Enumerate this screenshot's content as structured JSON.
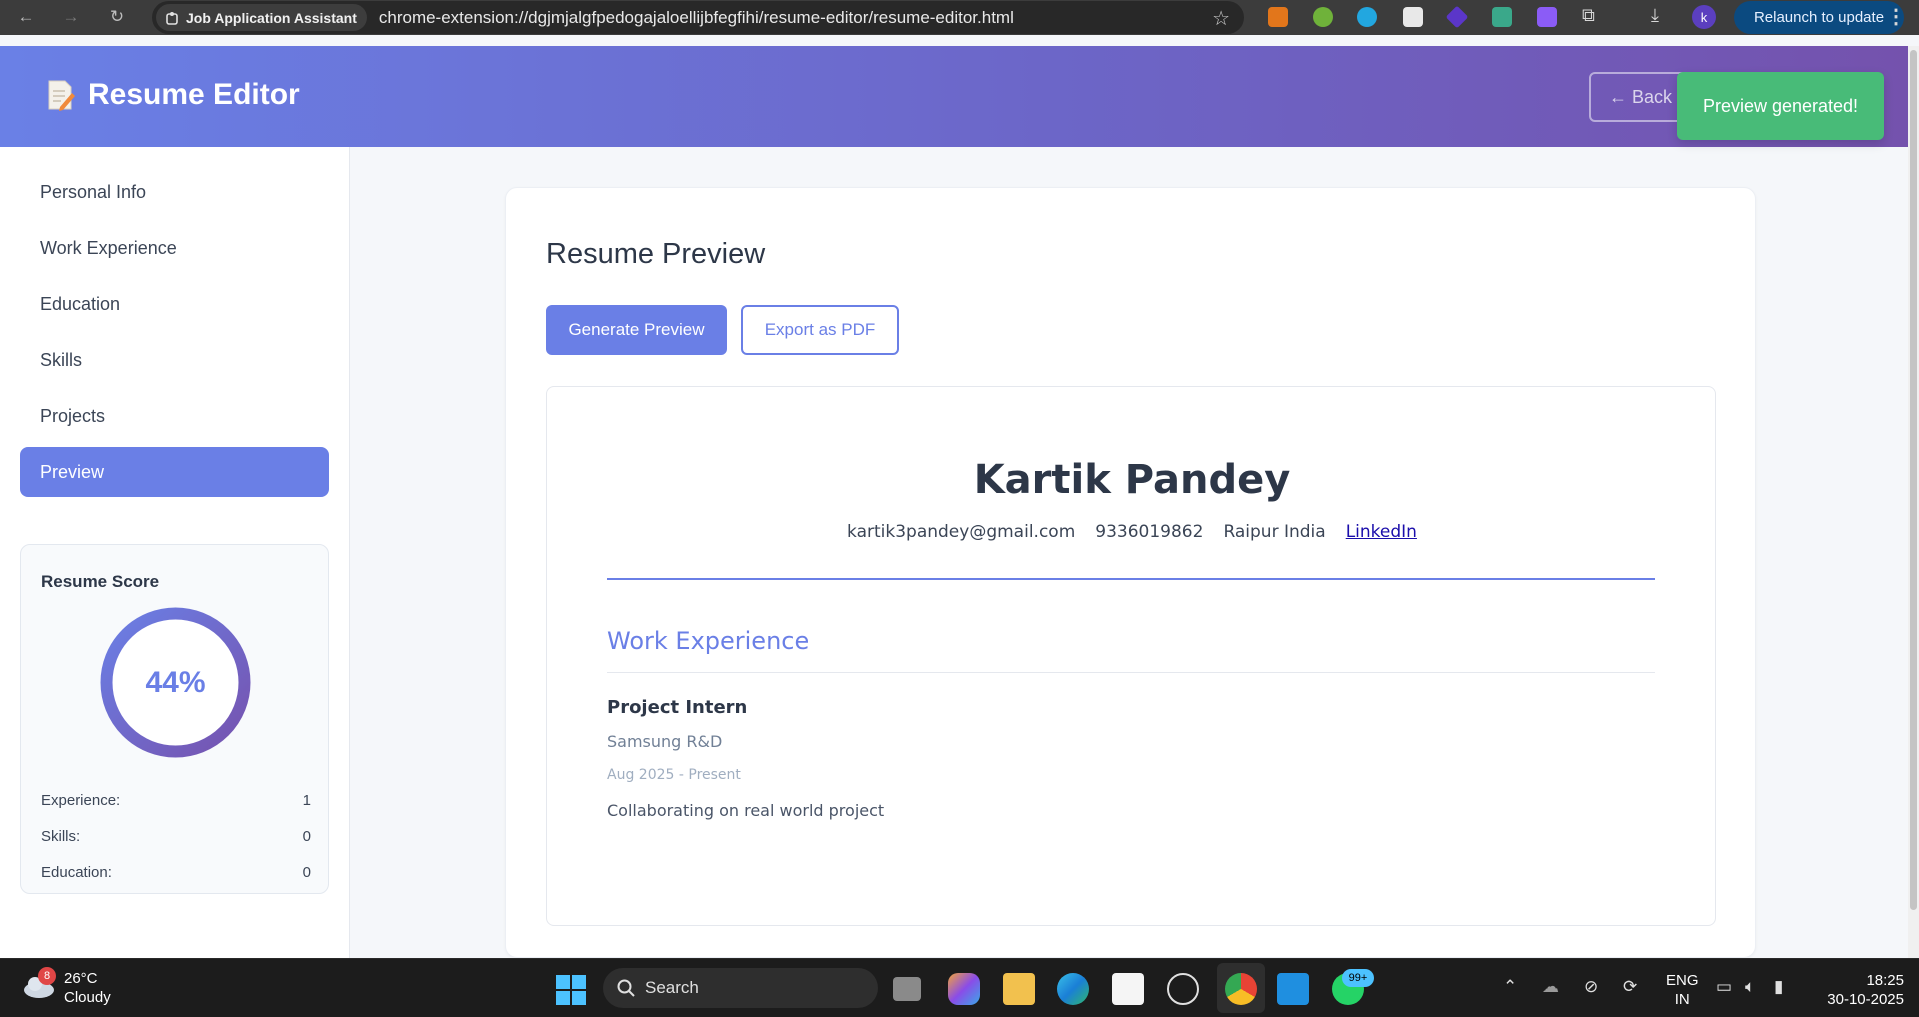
{
  "browser": {
    "extension_name": "Job Application Assistant",
    "url": "chrome-extension://dgjmjalgfpedogajaloellijbfegfihi/resume-editor/resume-editor.html",
    "profile_initial": "k",
    "relaunch_label": "Relaunch to update"
  },
  "header": {
    "title": "Resume Editor",
    "back_label": "← Back"
  },
  "sidebar": {
    "items": [
      {
        "label": "Personal Info"
      },
      {
        "label": "Work Experience"
      },
      {
        "label": "Education"
      },
      {
        "label": "Skills"
      },
      {
        "label": "Projects"
      },
      {
        "label": "Preview"
      }
    ],
    "active": "Preview"
  },
  "score": {
    "title": "Resume Score",
    "percent_label": "44%",
    "percent_value": 44,
    "stats": [
      {
        "label": "Experience:",
        "value": "1"
      },
      {
        "label": "Skills:",
        "value": "0"
      },
      {
        "label": "Education:",
        "value": "0"
      }
    ]
  },
  "main": {
    "section_title": "Resume Preview",
    "generate_label": "Generate Preview",
    "export_label": "Export as PDF"
  },
  "resume": {
    "name": "Kartik Pandey",
    "email": "kartik3pandey@gmail.com",
    "phone": "9336019862",
    "location": "Raipur India",
    "linkedin_label": "LinkedIn",
    "work_title": "Work Experience",
    "job": {
      "title": "Project Intern",
      "company": "Samsung R&D",
      "dates": "Aug 2025 - Present",
      "description": "Collaborating on real world project"
    }
  },
  "toast": {
    "message": "Preview generated!"
  },
  "taskbar": {
    "weather_badge": "8",
    "temperature": "26°C",
    "condition": "Cloudy",
    "search_label": "Search",
    "whatsapp_badge": "99+",
    "lang_line1": "ENG",
    "lang_line2": "IN",
    "time": "18:25",
    "date": "30-10-2025"
  },
  "colors": {
    "accent": "#6a7fe6",
    "toast": "#48bb78",
    "header_start": "#6a80e6",
    "header_end": "#7452ad"
  }
}
